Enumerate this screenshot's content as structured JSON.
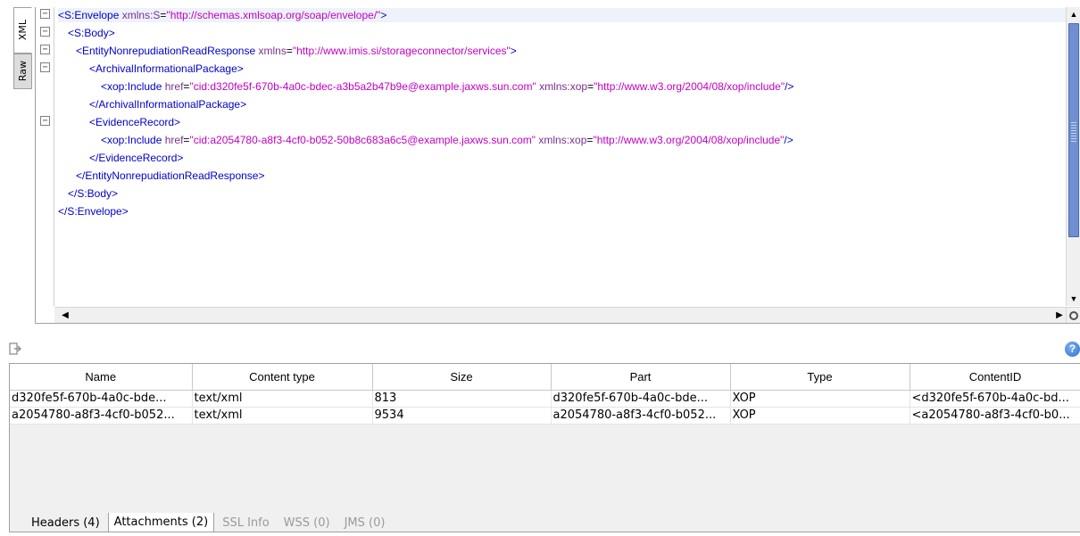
{
  "side_tabs": {
    "xml": "XML",
    "raw": "Raw"
  },
  "xml": {
    "envelope_open": "<S:Envelope",
    "envelope_attr": "xmlns:S",
    "envelope_ns": "\"http://schemas.xmlsoap.org/soap/envelope/\"",
    "body_open": "<S:Body>",
    "response_open": "<EntityNonrepudiationReadResponse",
    "response_attr": "xmlns",
    "response_ns": "\"http://www.imis.si/storageconnector/services\"",
    "archival_open": "<ArchivalInformationalPackage>",
    "include_tag": "<xop:Include",
    "href_attr": "href",
    "href1": "\"cid:d320fe5f-670b-4a0c-bdec-a3b5a2b47b9e@example.jaxws.sun.com\"",
    "xop_attr": "xmlns:xop",
    "xop_ns": "\"http://www.w3.org/2004/08/xop/include\"",
    "self_close": "/>",
    "archival_close": "</ArchivalInformationalPackage>",
    "evidence_open": "<EvidenceRecord>",
    "href2": "\"cid:a2054780-a8f3-4cf0-b052-50b8c683a6c5@example.jaxws.sun.com\"",
    "evidence_close": "</EvidenceRecord>",
    "response_close": "</EntityNonrepudiationReadResponse>",
    "body_close": "</S:Body>",
    "envelope_close": "</S:Envelope>"
  },
  "attachments": {
    "columns": [
      "Name",
      "Content type",
      "Size",
      "Part",
      "Type",
      "ContentID"
    ],
    "rows": [
      [
        "d320fe5f-670b-4a0c-bde...",
        "text/xml",
        "813",
        "d320fe5f-670b-4a0c-bde...",
        "XOP",
        "<d320fe5f-670b-4a0c-bd..."
      ],
      [
        "a2054780-a8f3-4cf0-b052...",
        "text/xml",
        "9534",
        "a2054780-a8f3-4cf0-b052...",
        "XOP",
        "<a2054780-a8f3-4cf0-b0..."
      ]
    ]
  },
  "bottom_tabs": {
    "headers": "Headers (4)",
    "attachments": "Attachments (2)",
    "ssl": "SSL Info",
    "wss": "WSS (0)",
    "jms": "JMS (0)"
  },
  "help_label": "?",
  "colors": {
    "tag": "#0000c8",
    "bracket": "#d00000",
    "attr": "#7a3090",
    "value": "#c000c0",
    "scroll_thumb": "#6f8fd0"
  }
}
